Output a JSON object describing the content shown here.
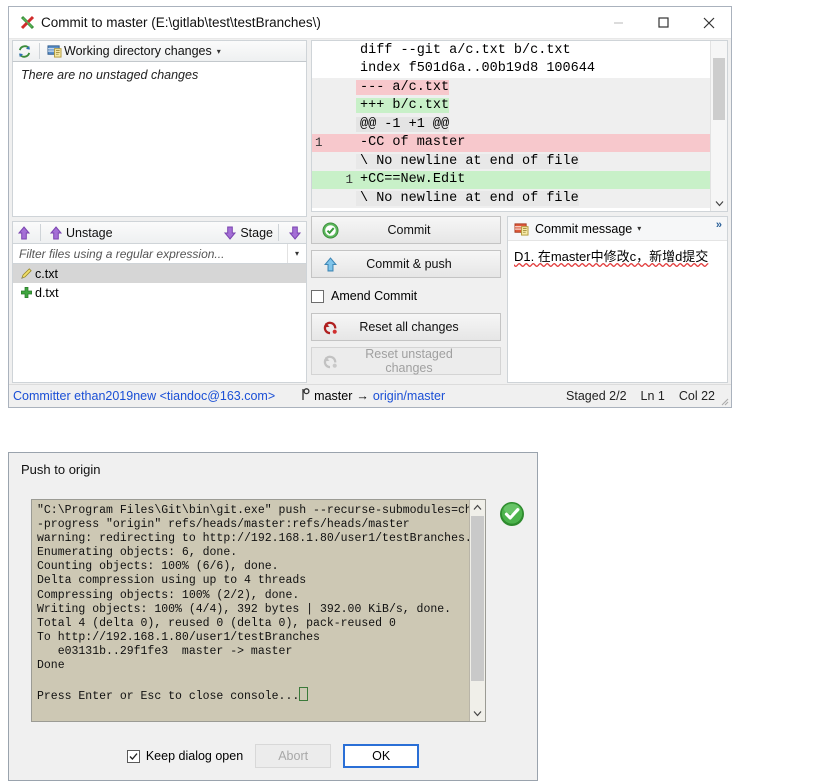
{
  "commit_window": {
    "title": "Commit to master (E:\\gitlab\\test\\testBranches\\)",
    "title_icon": "gitextensions-logo-icon",
    "window_buttons": {
      "minimize": "minimize-icon",
      "maximize": "maximize-icon",
      "close": "close-icon"
    },
    "unstaged": {
      "refresh_icon": "refresh-icon",
      "panel_icon": "working-directory-icon",
      "panel_label": "Working directory changes",
      "dropdown_caret": "▾",
      "empty_text": "There are no unstaged changes"
    },
    "stage_toolbar": {
      "unstage_all_icon": "arrow-up-icon",
      "unstage_icon": "arrow-up-icon",
      "unstage_label": "Unstage",
      "stage_label": "Stage",
      "stage_icon": "arrow-down-icon",
      "stage_all_icon": "arrow-down-icon"
    },
    "filter": {
      "placeholder": "Filter files using a regular expression...",
      "value": "",
      "dropdown_caret": "▾"
    },
    "files": [
      {
        "name": "c.txt",
        "status_icon": "pencil-modified-icon",
        "selected": true
      },
      {
        "name": "d.txt",
        "status_icon": "plus-added-icon",
        "selected": false
      }
    ],
    "diff": {
      "lines": [
        {
          "old": "",
          "new": "",
          "text": "diff --git a/c.txt b/c.txt",
          "type": "header"
        },
        {
          "old": "",
          "new": "",
          "text": "index f501d6a..00b19d8 100644",
          "type": "header"
        },
        {
          "old": "",
          "new": "",
          "text": "--- a/c.txt",
          "type": "removed"
        },
        {
          "old": "",
          "new": "",
          "text": "+++ b/c.txt",
          "type": "added"
        },
        {
          "old": "",
          "new": "",
          "text": "@@ -1 +1 @@",
          "type": "hunk"
        },
        {
          "old": "1",
          "new": "",
          "text": "-CC of master",
          "type": "removed"
        },
        {
          "old": "",
          "new": "",
          "text": "\\ No newline at end of file",
          "type": "meta"
        },
        {
          "old": "",
          "new": "1",
          "text": "+CC==New.Edit",
          "type": "added"
        },
        {
          "old": "",
          "new": "",
          "text": "\\ No newline at end of file",
          "type": "meta"
        }
      ],
      "scroll_up_icon": "chevron-up-icon",
      "scroll_down_icon": "chevron-down-icon"
    },
    "actions": {
      "commit_label": "Commit",
      "commit_icon": "green-check-icon",
      "commit_push_label": "Commit & push",
      "commit_push_icon": "arrow-up-blue-icon",
      "amend_label": "Amend Commit",
      "amend_checked": false,
      "reset_all_label": "Reset all changes",
      "reset_all_icon": "reset-icon",
      "reset_unstaged_label": "Reset unstaged changes",
      "reset_unstaged_icon": "reset-icon",
      "reset_unstaged_disabled": true
    },
    "commit_message": {
      "panel_icon": "commit-message-icon",
      "panel_label": "Commit message",
      "dropdown_caret": "▾",
      "expander": "»",
      "text": "D1. 在master中修改c，新增d提交"
    },
    "status_bar": {
      "committer": "Committer ethan2019new <tiandoc@163.com>",
      "branch_icon": "branch-icon",
      "local_branch": "master",
      "arrow": "→",
      "remote_branch": "origin/master",
      "staged": "Staged 2/2",
      "line": "Ln 1",
      "column": "Col 22"
    }
  },
  "push_dialog": {
    "title": "Push to origin",
    "status_icon": "green-check-icon",
    "console_text": "\"C:\\Program Files\\Git\\bin\\git.exe\" push --recurse-submodules=check -\n-progress \"origin\" refs/heads/master:refs/heads/master\nwarning: redirecting to http://192.168.1.80/user1/testBranches.git/\nEnumerating objects: 6, done.\nCounting objects: 100% (6/6), done.\nDelta compression using up to 4 threads\nCompressing objects: 100% (2/2), done.\nWriting objects: 100% (4/4), 392 bytes | 392.00 KiB/s, done.\nTotal 4 (delta 0), reused 0 (delta 0), pack-reused 0\nTo http://192.168.1.80/user1/testBranches\n   e03131b..29f1fe3  master -> master\nDone\n",
    "console_prompt": "Press Enter or Esc to close console...",
    "scroll_up_icon": "chevron-up-icon",
    "scroll_down_icon": "chevron-down-icon",
    "keep_open_label": "Keep dialog open",
    "keep_open_checked": true,
    "abort_label": "Abort",
    "abort_disabled": true,
    "ok_label": "OK"
  },
  "colors": {
    "diff_removed_bg": "#f7c8cc",
    "diff_added_bg": "#c8f0c8",
    "diff_meta_bg": "#e8e8e8",
    "link_blue": "#1a4fd6",
    "console_bg": "#cdc8b4",
    "accent_green": "#3f9c35",
    "purple_arrow": "#9b59d0"
  }
}
